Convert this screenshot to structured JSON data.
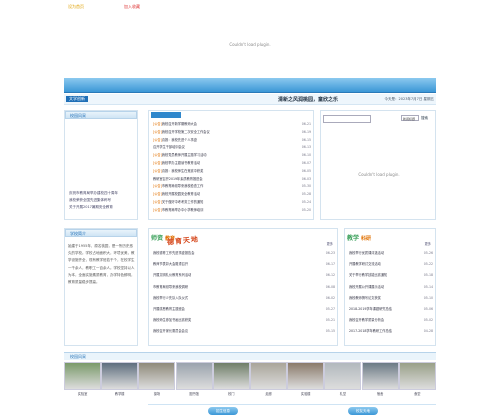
{
  "header": {
    "link1": "设为首页",
    "link2": "加入收藏"
  },
  "banner": {
    "flash_placeholder": "Couldn't load plugin."
  },
  "infobar": {
    "tag": "文学创新",
    "marquee": "清新之风润桃园，童欣之乐",
    "date": "今天是：2023年7月7日 星期五"
  },
  "left_top": {
    "title": "校园风采",
    "items": [
      "庆祝市教育局举办建校四十周年",
      "我校荣获全国先进集体称号",
      "关于开展2017暑期安全教育"
    ]
  },
  "left_bottom": {
    "title": "学校简介",
    "text": "始建于1955年，原名桃园，是一所历史悠久的学校。学校占地面积大，环境优美，教学设施齐全，现有教学班若干个，在校学生一千余人，教职工一百余人。学校坚持以人为本，全面实施素质教育，办学特色鲜明，教育质量稳步提高。"
  },
  "news": {
    "tab": "新闻动态",
    "items": [
      {
        "tag": "[公告]",
        "title": "我校召开新学期教师大会",
        "date": "06-21"
      },
      {
        "tag": "[公告]",
        "title": "我校召开学校第二次安全工作会议",
        "date": "06-19"
      },
      {
        "tag": "[公告]",
        "title": "喜报：我校先进个人事迹",
        "date": "06-15"
      },
      {
        "tag": "",
        "title": "召开学生干部培训会议",
        "date": "06-13"
      },
      {
        "tag": "[公告]",
        "title": "我校党员教师开展主题学习活动",
        "date": "06-10"
      },
      {
        "tag": "[公告]",
        "title": "我校举办主题读书教育活动",
        "date": "06-07"
      },
      {
        "tag": "[公告]",
        "title": "喜报：我校师生在竞赛中获奖",
        "date": "06-05"
      },
      {
        "tag": "",
        "title": "教研室召开2019年素质教育推进会",
        "date": "06-03"
      },
      {
        "tag": "[公告]",
        "title": "市教育局领导来我校检查工作",
        "date": "05-30"
      },
      {
        "tag": "[公告]",
        "title": "我校开展校园安全教育活动",
        "date": "05-28"
      },
      {
        "tag": "[公告]",
        "title": "关于做好中考考务工作的通知",
        "date": "05-24"
      },
      {
        "tag": "[公告]",
        "title": "市教育局举办中小学教师培训",
        "date": "05-20"
      }
    ]
  },
  "search": {
    "select": "新闻标题",
    "button": "搜索",
    "flash_placeholder": "Couldn't load plugin."
  },
  "sec_edu": {
    "logo": "师资",
    "logo2": "教育",
    "stamp": "德育天地",
    "more": "更多",
    "items": [
      {
        "title": "我校德育工作先进事迹报告会",
        "date": "06-23"
      },
      {
        "title": "教师节表彰大会隆重召开",
        "date": "06-17"
      },
      {
        "title": "开展文明礼仪教育系列活动",
        "date": "06-12"
      },
      {
        "title": "市教育局领导来我校调研",
        "date": "06-08"
      },
      {
        "title": "我校举行少先队入队仪式",
        "date": "06-02"
      },
      {
        "title": "开展感恩教育主题班会",
        "date": "05-27"
      },
      {
        "title": "我校师生参加书画比赛获奖",
        "date": "05-21"
      },
      {
        "title": "我校召开家长委员会会议",
        "date": "05-15"
      }
    ]
  },
  "sec_teach": {
    "logo": "教学",
    "logo2": "科研",
    "more": "更多",
    "items": [
      {
        "title": "我校举行优质课评选活动",
        "date": "05-26"
      },
      {
        "title": "开展教学研讨交流活动",
        "date": "05-22"
      },
      {
        "title": "关于举行教学技能比赛通知",
        "date": "05-18"
      },
      {
        "title": "我校开展公开课展示活动",
        "date": "05-14"
      },
      {
        "title": "我校教师撰写论文获奖",
        "date": "05-10"
      },
      {
        "title": "2018-2019学年课题研究总结",
        "date": "05-06"
      },
      {
        "title": "我校召开教学质量分析会",
        "date": "05-02"
      },
      {
        "title": "2017-2018学年教研工作总结",
        "date": "04-28"
      }
    ]
  },
  "photos": {
    "title": "校园风采",
    "captions": [
      "实验室",
      "教学楼",
      "操场",
      "图书馆",
      "校门",
      "走廊",
      "实验楼",
      "礼堂",
      "宿舍",
      "食堂"
    ]
  },
  "bottom": {
    "tab1": "招生信息",
    "tab2": "校友天地"
  }
}
